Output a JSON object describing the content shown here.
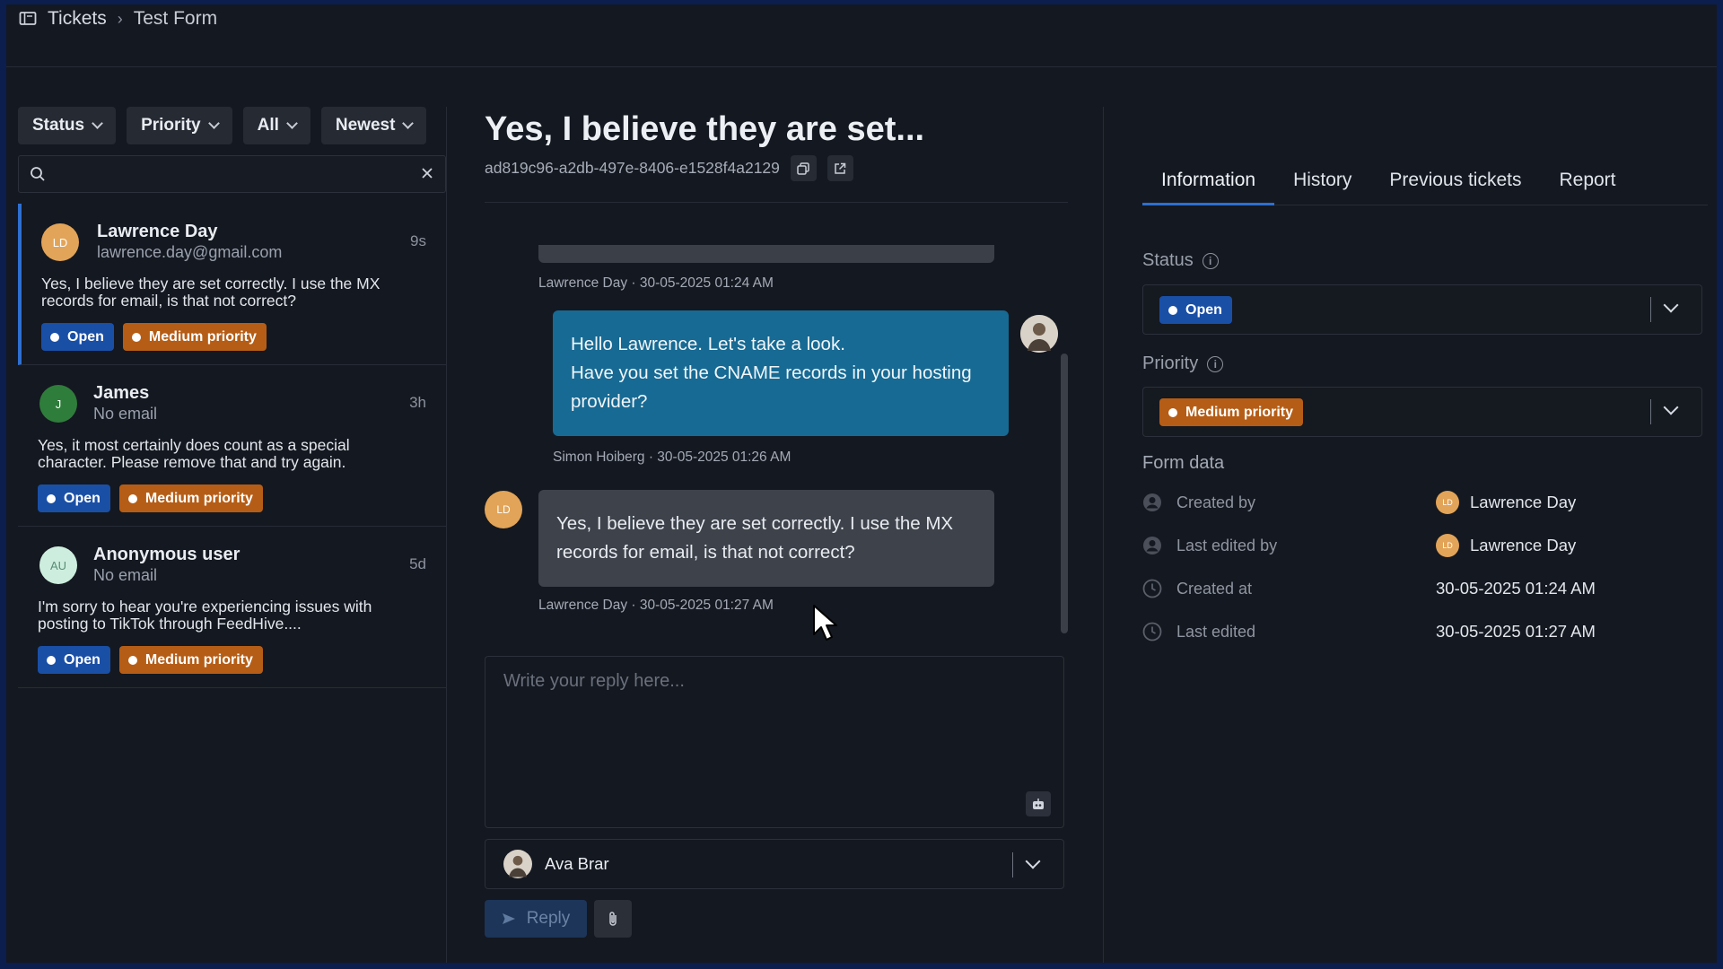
{
  "breadcrumb": {
    "root": "Tickets",
    "current": "Test Form"
  },
  "filters": {
    "status": "Status",
    "priority": "Priority",
    "scope": "All",
    "sort": "Newest"
  },
  "search": {
    "placeholder": ""
  },
  "tickets": [
    {
      "initials": "LD",
      "name": "Lawrence Day",
      "email": "lawrence.day@gmail.com",
      "time": "9s",
      "preview": "Yes, I believe they are set correctly. I use the MX records for email, is that not correct?",
      "status": "Open",
      "priority": "Medium priority",
      "avatar_color": "#e2a458"
    },
    {
      "initials": "J",
      "name": "James",
      "email": "No email",
      "time": "3h",
      "preview": "Yes, it most certainly does count as a special character. Please remove that and try again.",
      "status": "Open",
      "priority": "Medium priority",
      "avatar_color": "#2f7d3b"
    },
    {
      "initials": "AU",
      "name": "Anonymous user",
      "email": "No email",
      "time": "5d",
      "preview": "I'm sorry to hear you're experiencing issues with posting to TikTok through FeedHive....",
      "status": "Open",
      "priority": "Medium priority",
      "avatar_color": "#cdeede"
    }
  ],
  "ticket": {
    "title": "Yes, I believe they are set...",
    "id": "ad819c96-a2db-497e-8406-e1528f4a2129"
  },
  "messages": {
    "m0_meta": "Lawrence Day · 30-05-2025 01:24 AM",
    "m1_line1": "Hello Lawrence. Let's take a look.",
    "m1_line2": "Have you set the CNAME records in your hosting provider?",
    "m1_meta": "Simon Hoiberg · 30-05-2025 01:26 AM",
    "m2_text": "Yes, I believe they are set correctly. I use the MX records for email, is that not correct?",
    "m2_meta": "Lawrence Day · 30-05-2025 01:27 AM",
    "m2_initials": "LD"
  },
  "reply": {
    "placeholder": "Write your reply here...",
    "assignee": "Ava Brar",
    "send_label": "Reply"
  },
  "tabs": [
    "Information",
    "History",
    "Previous tickets",
    "Report"
  ],
  "info": {
    "status_label": "Status",
    "status_value": "Open",
    "priority_label": "Priority",
    "priority_value": "Medium priority",
    "form_data_heading": "Form data",
    "rows": [
      {
        "key": "Created by",
        "value": "Lawrence Day",
        "avatar": "LD"
      },
      {
        "key": "Last edited by",
        "value": "Lawrence Day",
        "avatar": "LD"
      },
      {
        "key": "Created at",
        "value": "30-05-2025 01:24 AM"
      },
      {
        "key": "Last edited",
        "value": "30-05-2025 01:27 AM"
      }
    ]
  },
  "colors": {
    "accent": "#2e6fd1",
    "open_badge": "#1a4fa6",
    "priority_badge": "#b55d16",
    "agent_bubble": "#176a93",
    "user_bubble": "#3d424b"
  },
  "icons": {
    "breadcrumb": "tickets-icon",
    "search": "search-icon",
    "clear": "close-icon",
    "copy": "copy-icon",
    "open_external": "external-link-icon",
    "bot": "bot-icon",
    "send": "send-icon",
    "attach": "paperclip-icon",
    "info": "info-icon",
    "user": "user-icon",
    "clock": "clock-icon"
  }
}
